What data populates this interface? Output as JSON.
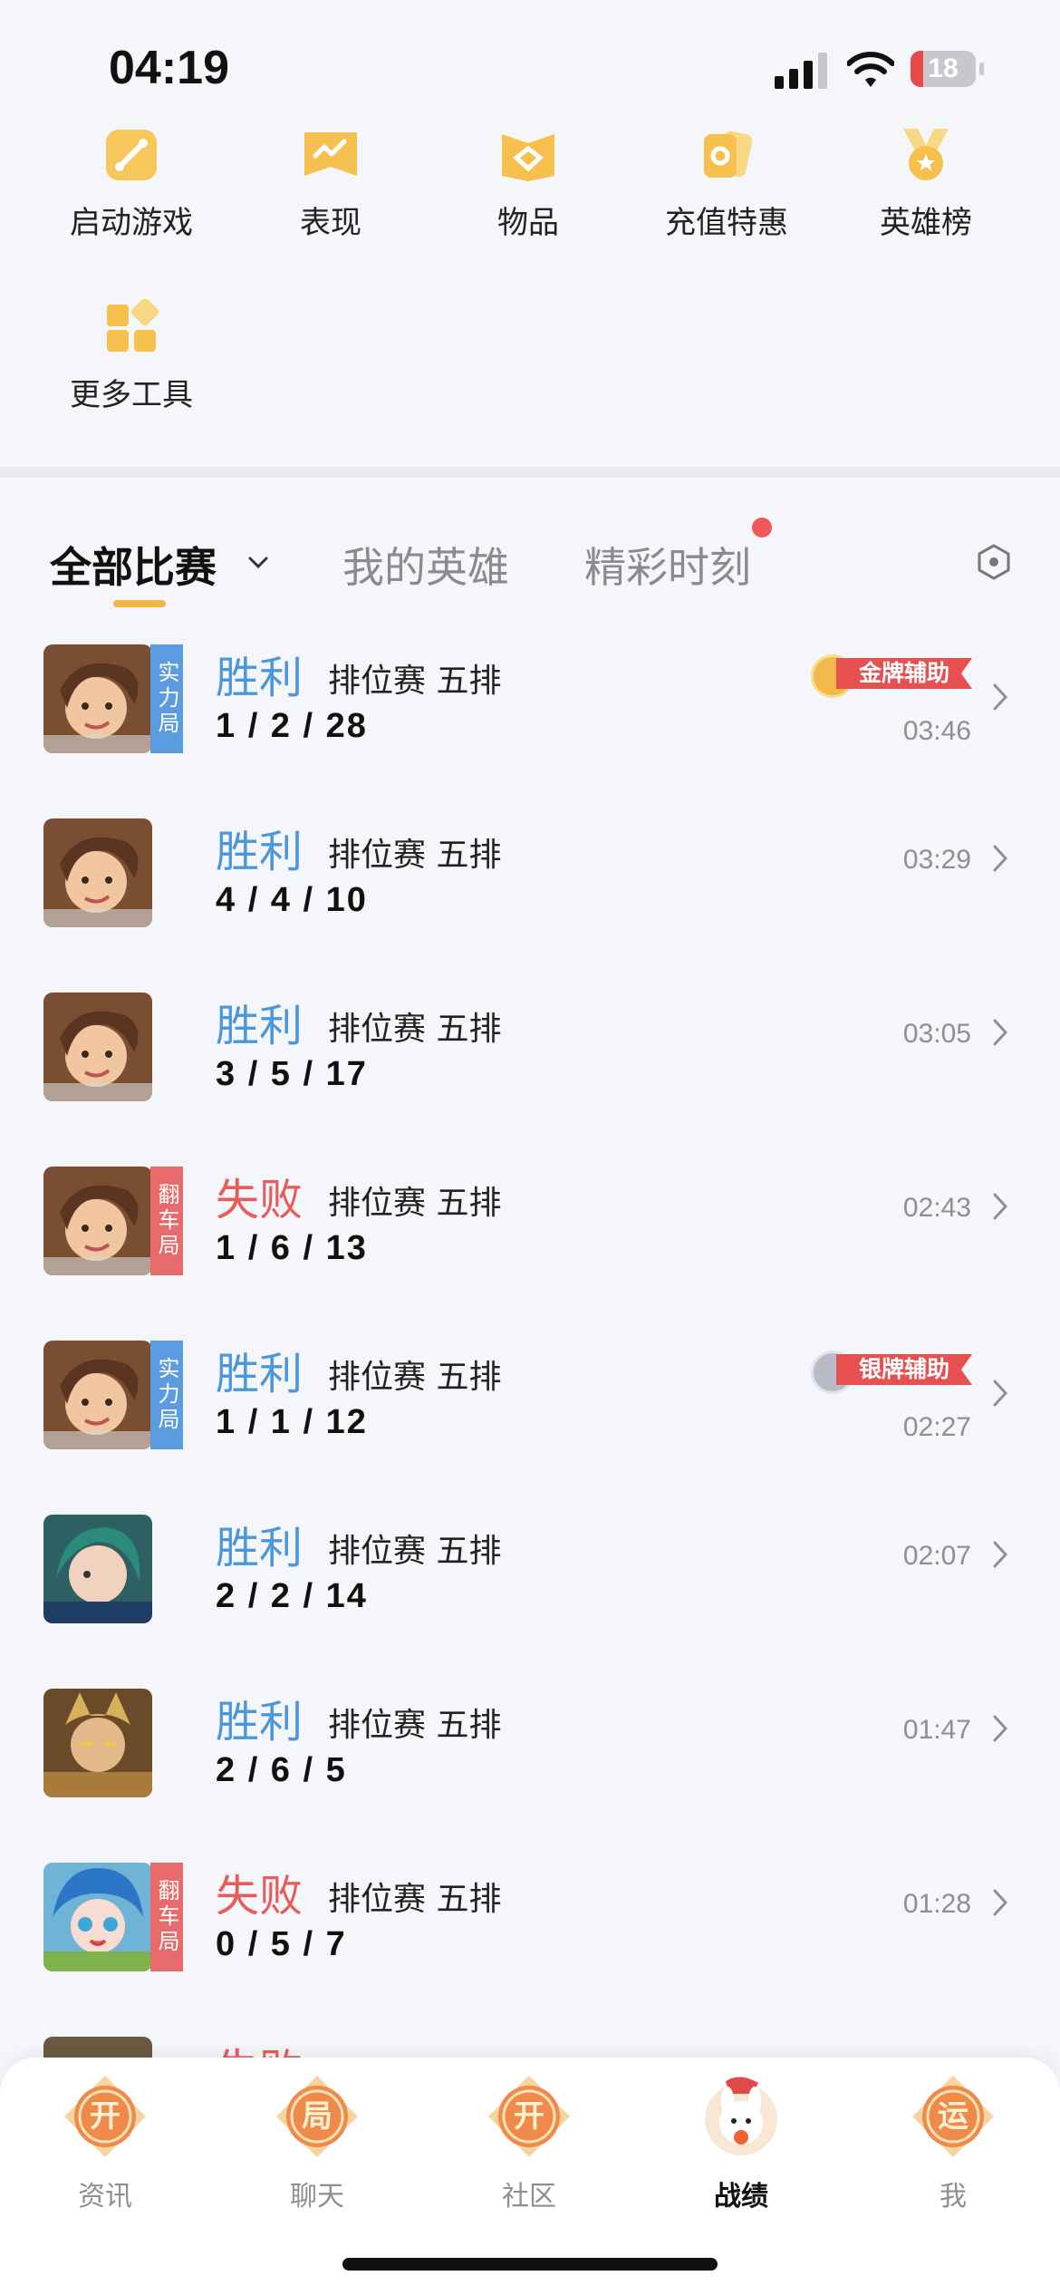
{
  "status_bar": {
    "time": "04:19",
    "battery": "18"
  },
  "tools": [
    {
      "label": "启动游戏",
      "icon": "gamepad-icon"
    },
    {
      "label": "表现",
      "icon": "chart-icon"
    },
    {
      "label": "物品",
      "icon": "gift-icon"
    },
    {
      "label": "充值特惠",
      "icon": "coupon-icon"
    },
    {
      "label": "英雄榜",
      "icon": "medal-icon"
    },
    {
      "label": "更多工具",
      "icon": "apps-icon"
    }
  ],
  "tabs": [
    {
      "label": "全部比赛",
      "active": true
    },
    {
      "label": "我的英雄",
      "active": false
    },
    {
      "label": "精彩时刻",
      "active": false,
      "has_dot": true
    }
  ],
  "matches": [
    {
      "result": "胜利",
      "outcome": "win",
      "mode": "排位赛 五排",
      "kda": "1 / 2 / 28",
      "duration": "03:46",
      "tag": "实力局",
      "badge": "金牌辅助"
    },
    {
      "result": "胜利",
      "outcome": "win",
      "mode": "排位赛 五排",
      "kda": "4 / 4 / 10",
      "duration": "03:29",
      "tag": "",
      "badge": ""
    },
    {
      "result": "胜利",
      "outcome": "win",
      "mode": "排位赛 五排",
      "kda": "3 / 5 / 17",
      "duration": "03:05",
      "tag": "",
      "badge": ""
    },
    {
      "result": "失败",
      "outcome": "lose",
      "mode": "排位赛 五排",
      "kda": "1 / 6 / 13",
      "duration": "02:43",
      "tag": "翻车局",
      "badge": ""
    },
    {
      "result": "胜利",
      "outcome": "win",
      "mode": "排位赛 五排",
      "kda": "1 / 1 / 12",
      "duration": "02:27",
      "tag": "实力局",
      "badge": "银牌辅助"
    },
    {
      "result": "胜利",
      "outcome": "win",
      "mode": "排位赛 五排",
      "kda": "2 / 2 / 14",
      "duration": "02:07",
      "tag": "",
      "badge": ""
    },
    {
      "result": "胜利",
      "outcome": "win",
      "mode": "排位赛 五排",
      "kda": "2 / 6 / 5",
      "duration": "01:47",
      "tag": "",
      "badge": ""
    },
    {
      "result": "失败",
      "outcome": "lose",
      "mode": "排位赛 五排",
      "kda": "0 / 5 / 7",
      "duration": "01:28",
      "tag": "翻车局",
      "badge": ""
    },
    {
      "result": "失败",
      "outcome": "lose",
      "mode": "",
      "kda": "",
      "duration": "",
      "tag": "",
      "badge": ""
    }
  ],
  "bottom_nav": [
    {
      "label": "资讯",
      "glyph": "开",
      "active": false
    },
    {
      "label": "聊天",
      "glyph": "局",
      "active": false
    },
    {
      "label": "社区",
      "glyph": "开",
      "active": false
    },
    {
      "label": "战绩",
      "glyph": "",
      "active": true
    },
    {
      "label": "我",
      "glyph": "运",
      "active": false
    }
  ],
  "colors": {
    "win": "#4a97dc",
    "lose": "#e75b5b",
    "accent": "#f2b54a",
    "tag_win": "#5b9be0",
    "tag_lose": "#e86a6a"
  }
}
